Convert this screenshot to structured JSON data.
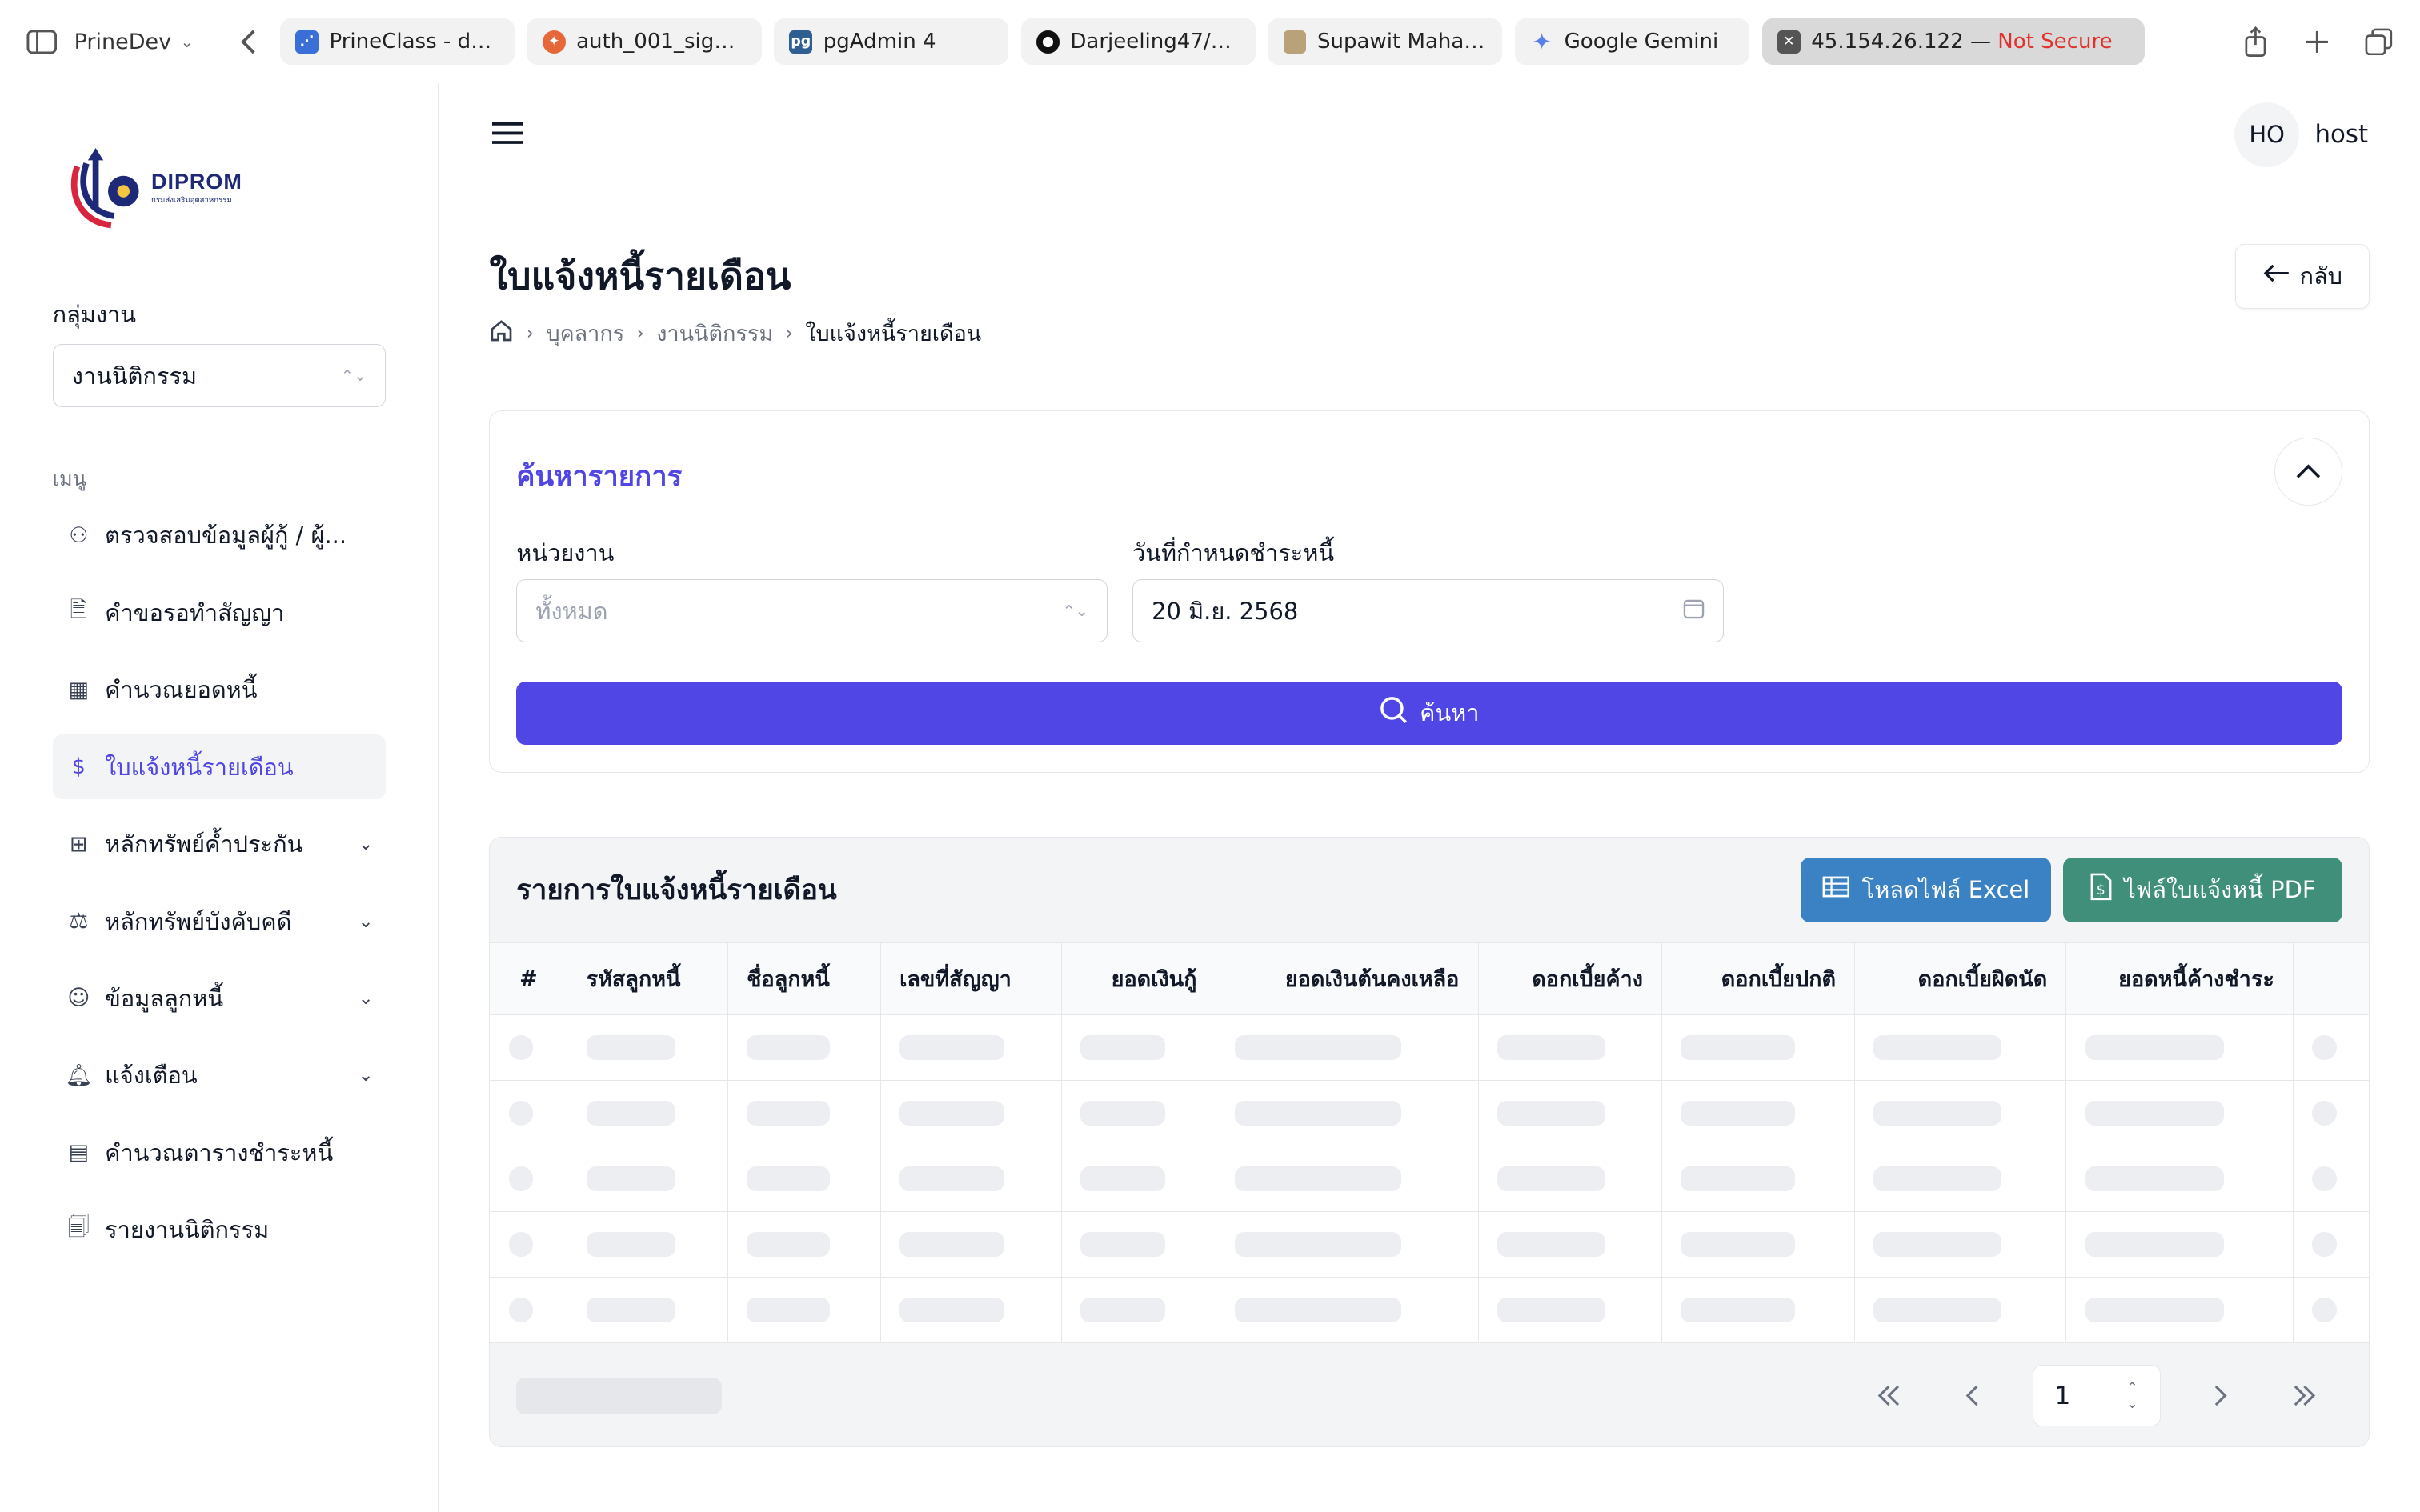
{
  "browser": {
    "profile": "PrineDev",
    "tabs": [
      {
        "label": "PrineClass - db...",
        "color": "#3b6fd8",
        "icon": "share-nodes-icon"
      },
      {
        "label": "auth_001_signIn...",
        "color": "#e5673a",
        "icon": "swirl-icon"
      },
      {
        "label": "pgAdmin 4",
        "color": "#2f5f91",
        "icon": "pgadmin-icon"
      },
      {
        "label": "Darjeeling47/Po...",
        "color": "#111111",
        "icon": "github-icon"
      },
      {
        "label": "Supawit Mahadt...",
        "color": "#b9a27a",
        "icon": "avatar-icon"
      },
      {
        "label": "Google Gemini",
        "color": "#5b7fe8",
        "icon": "gemini-icon"
      }
    ],
    "active_tab": {
      "host": "45.154.26.122",
      "sep": " — ",
      "warning": "Not Secure"
    }
  },
  "sidebar": {
    "logo_text": "DIPROM",
    "logo_sub": "กรมส่งเสริมอุตสาหกรรม",
    "group_label": "กลุ่มงาน",
    "group_value": "งานนิติกรรม",
    "menu_label": "เมนู",
    "items": [
      {
        "label": "ตรวจสอบข้อมูลผู้กู้ / ผู้...",
        "icon": "user-plus-icon",
        "has_chevron": false
      },
      {
        "label": "คำขอรอทำสัญญา",
        "icon": "file-check-icon",
        "has_chevron": false
      },
      {
        "label": "คำนวณยอดหนี้",
        "icon": "calculator-icon",
        "has_chevron": false
      },
      {
        "label": "ใบแจ้งหนี้รายเดือน",
        "icon": "file-dollar-icon",
        "has_chevron": false,
        "active": true
      },
      {
        "label": "หลักทรัพย์ค้ำประกัน",
        "icon": "grid-icon",
        "has_chevron": true
      },
      {
        "label": "หลักทรัพย์บังคับคดี",
        "icon": "scale-icon",
        "has_chevron": true
      },
      {
        "label": "ข้อมูลลูกหนี้",
        "icon": "user-circle-icon",
        "has_chevron": true
      },
      {
        "label": "แจ้งเตือน",
        "icon": "bell-icon",
        "has_chevron": true
      },
      {
        "label": "คำนวณตารางชำระหนี้",
        "icon": "table-icon",
        "has_chevron": false
      },
      {
        "label": "รายงานนิติกรรม",
        "icon": "files-icon",
        "has_chevron": false
      }
    ]
  },
  "header": {
    "avatar": "HO",
    "user": "host"
  },
  "page": {
    "title": "ใบแจ้งหนี้รายเดือน",
    "back_label": "กลับ",
    "breadcrumb": [
      "บุคลากร",
      "งานนิติกรรม",
      "ใบแจ้งหนี้รายเดือน"
    ]
  },
  "search": {
    "title": "ค้นหารายการ",
    "unit_label": "หน่วยงาน",
    "unit_placeholder": "ทั้งหมด",
    "date_label": "วันที่กำหนดชำระหนี้",
    "date_value": "20 มิ.ย. 2568",
    "button": "ค้นหา"
  },
  "table": {
    "title": "รายการใบแจ้งหนี้รายเดือน",
    "excel_button": "โหลดไฟล์ Excel",
    "pdf_button": "ไฟล์ใบแจ้งหนี้ PDF",
    "columns": [
      "#",
      "รหัสลูกหนี้",
      "ชื่อลูกหนี้",
      "เลขที่สัญญา",
      "ยอดเงินกู้",
      "ยอดเงินต้นคงเหลือ",
      "ดอกเบี้ยค้าง",
      "ดอกเบี้ยปกติ",
      "ดอกเบี้ยผิดนัด",
      "ยอดหนี้ค้างชำระ",
      ""
    ],
    "page_number": "1"
  },
  "colors": {
    "accent": "#4f46e5",
    "excel": "#3b82c4",
    "pdf": "#3f8f7a",
    "insecure": "#e0312b"
  }
}
